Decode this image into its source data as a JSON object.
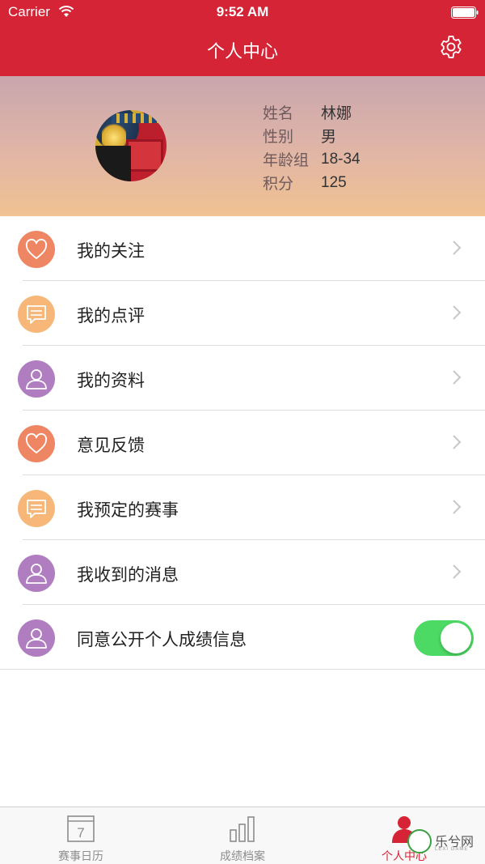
{
  "status_bar": {
    "carrier": "Carrier",
    "time": "9:52 AM"
  },
  "nav": {
    "title": "个人中心",
    "settings_icon": "gear-icon"
  },
  "profile": {
    "fields": [
      {
        "label": "姓名",
        "value": "林娜"
      },
      {
        "label": "性别",
        "value": "男"
      },
      {
        "label": "年龄组",
        "value": "18-34"
      },
      {
        "label": "积分",
        "value": "125"
      }
    ]
  },
  "menu": {
    "items": [
      {
        "label": "我的关注",
        "icon": "heart-icon",
        "color": "#ef8663"
      },
      {
        "label": "我的点评",
        "icon": "comment-icon",
        "color": "#f6b778"
      },
      {
        "label": "我的资料",
        "icon": "user-icon",
        "color": "#b07dc1"
      },
      {
        "label": "意见反馈",
        "icon": "heart-icon",
        "color": "#ef8663"
      },
      {
        "label": "我预定的赛事",
        "icon": "comment-icon",
        "color": "#f6b778"
      },
      {
        "label": "我收到的消息",
        "icon": "user-icon",
        "color": "#b07dc1"
      },
      {
        "label": "同意公开个人成绩信息",
        "icon": "user-icon",
        "color": "#b07dc1",
        "toggle_on": true
      }
    ]
  },
  "tabbar": {
    "tabs": [
      {
        "label": "赛事日历",
        "icon": "calendar-icon",
        "calendar_day": "7"
      },
      {
        "label": "成绩档案",
        "icon": "bar-chart-icon"
      },
      {
        "label": "个人中心",
        "icon": "person-icon",
        "active": true
      }
    ]
  },
  "watermark": {
    "text": "乐兮网",
    "sub": "LEXI GAME"
  },
  "colors": {
    "brand_red": "#d42436",
    "toggle_green": "#4cd964"
  }
}
